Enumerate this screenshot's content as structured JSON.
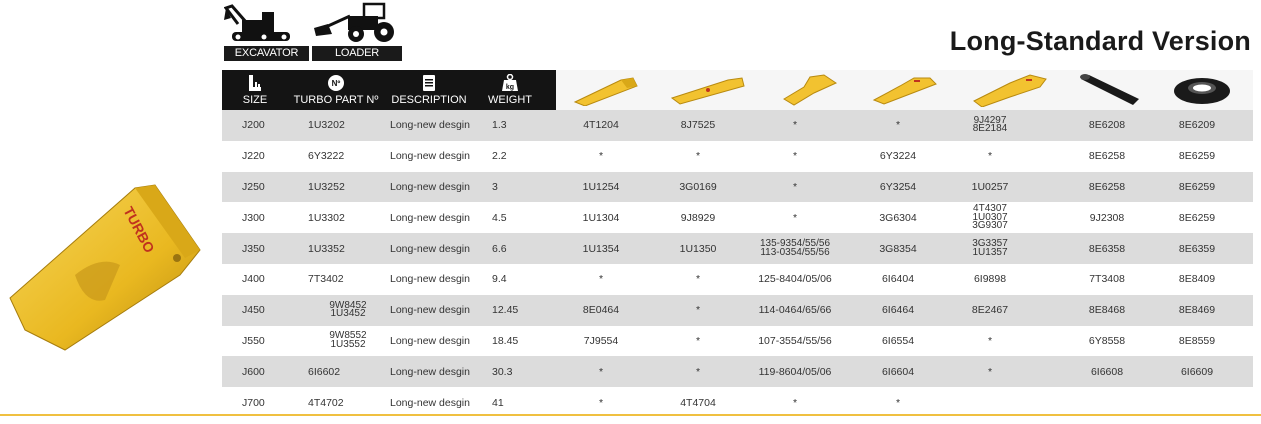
{
  "machines": [
    {
      "label": "EXCAVATOR",
      "icon": "excavator-icon"
    },
    {
      "label": "LOADER",
      "icon": "loader-icon"
    }
  ],
  "title": "Long-Standard Version",
  "headers": {
    "size": "SIZE",
    "part": "TURBO PART Nº",
    "description": "DESCRIPTION",
    "weight": "WEIGHT",
    "weight_badge": "kg",
    "part_badge": "Nº"
  },
  "part_columns": [
    {
      "icon": "tooth-icon"
    },
    {
      "icon": "long-tooth-icon"
    },
    {
      "icon": "adapter-icon"
    },
    {
      "icon": "weld-adapter-icon"
    },
    {
      "icon": "twin-adapter-icon"
    },
    {
      "icon": "pin-icon"
    },
    {
      "icon": "retainer-ring-icon"
    }
  ],
  "rows": [
    {
      "size": "J200",
      "part": [
        "1U3202"
      ],
      "desc": "Long-new desgin",
      "weight": "1.3",
      "cols": [
        [
          "4T1204"
        ],
        [
          "8J7525"
        ],
        [
          "*"
        ],
        [
          "*"
        ],
        [
          "9J4297",
          "8E2184"
        ],
        [
          "8E6208"
        ],
        [
          "8E6209"
        ]
      ]
    },
    {
      "size": "J220",
      "part": [
        "6Y3222"
      ],
      "desc": "Long-new desgin",
      "weight": "2.2",
      "cols": [
        [
          "*"
        ],
        [
          "*"
        ],
        [
          "*"
        ],
        [
          "6Y3224"
        ],
        [
          "*"
        ],
        [
          "8E6258"
        ],
        [
          "8E6259"
        ]
      ]
    },
    {
      "size": "J250",
      "part": [
        "1U3252"
      ],
      "desc": "Long-new desgin",
      "weight": "3",
      "cols": [
        [
          "1U1254"
        ],
        [
          "3G0169"
        ],
        [
          "*"
        ],
        [
          "6Y3254"
        ],
        [
          "1U0257"
        ],
        [
          "8E6258"
        ],
        [
          "8E6259"
        ]
      ]
    },
    {
      "size": "J300",
      "part": [
        "1U3302"
      ],
      "desc": "Long-new desgin",
      "weight": "4.5",
      "cols": [
        [
          "1U1304"
        ],
        [
          "9J8929"
        ],
        [
          "*"
        ],
        [
          "3G6304"
        ],
        [
          "4T4307",
          "1U0307",
          "3G9307"
        ],
        [
          "9J2308"
        ],
        [
          "8E6259"
        ]
      ]
    },
    {
      "size": "J350",
      "part": [
        "1U3352"
      ],
      "desc": "Long-new desgin",
      "weight": "6.6",
      "cols": [
        [
          "1U1354"
        ],
        [
          "1U1350"
        ],
        [
          "135-9354/55/56",
          "113-0354/55/56"
        ],
        [
          "3G8354"
        ],
        [
          "3G3357",
          "1U1357"
        ],
        [
          "8E6358"
        ],
        [
          "8E6359"
        ]
      ]
    },
    {
      "size": "J400",
      "part": [
        "7T3402"
      ],
      "desc": "Long-new desgin",
      "weight": "9.4",
      "cols": [
        [
          "*"
        ],
        [
          "*"
        ],
        [
          "125-8404/05/06"
        ],
        [
          "6I6404"
        ],
        [
          "6I9898"
        ],
        [
          "7T3408"
        ],
        [
          "8E8409"
        ]
      ]
    },
    {
      "size": "J450",
      "part": [
        "9W8452",
        "1U3452"
      ],
      "desc": "Long-new desgin",
      "weight": "12.45",
      "cols": [
        [
          "8E0464"
        ],
        [
          "*"
        ],
        [
          "114-0464/65/66"
        ],
        [
          "6I6464"
        ],
        [
          "8E2467"
        ],
        [
          "8E8468"
        ],
        [
          "8E8469"
        ]
      ]
    },
    {
      "size": "J550",
      "part": [
        "9W8552",
        "1U3552"
      ],
      "desc": "Long-new desgin",
      "weight": "18.45",
      "cols": [
        [
          "7J9554"
        ],
        [
          "*"
        ],
        [
          "107-3554/55/56"
        ],
        [
          "6I6554"
        ],
        [
          "*"
        ],
        [
          "6Y8558"
        ],
        [
          "8E8559"
        ]
      ]
    },
    {
      "size": "J600",
      "part": [
        "6I6602"
      ],
      "desc": "Long-new desgin",
      "weight": "30.3",
      "cols": [
        [
          "*"
        ],
        [
          "*"
        ],
        [
          "119-8604/05/06"
        ],
        [
          "6I6604"
        ],
        [
          "*"
        ],
        [
          "6I6608"
        ],
        [
          "6I6609"
        ]
      ]
    },
    {
      "size": "J700",
      "part": [
        "4T4702"
      ],
      "desc": "Long-new desgin",
      "weight": "41",
      "cols": [
        [
          "*"
        ],
        [
          "4T4704"
        ],
        [
          "*"
        ],
        [
          "*"
        ],
        [
          ""
        ],
        [
          ""
        ],
        [
          ""
        ]
      ]
    }
  ],
  "colors": {
    "yellow": "#f2c230",
    "header_dark": "#141414",
    "shade": "#dcdcdc",
    "bottom_rule": "#f0c040"
  }
}
